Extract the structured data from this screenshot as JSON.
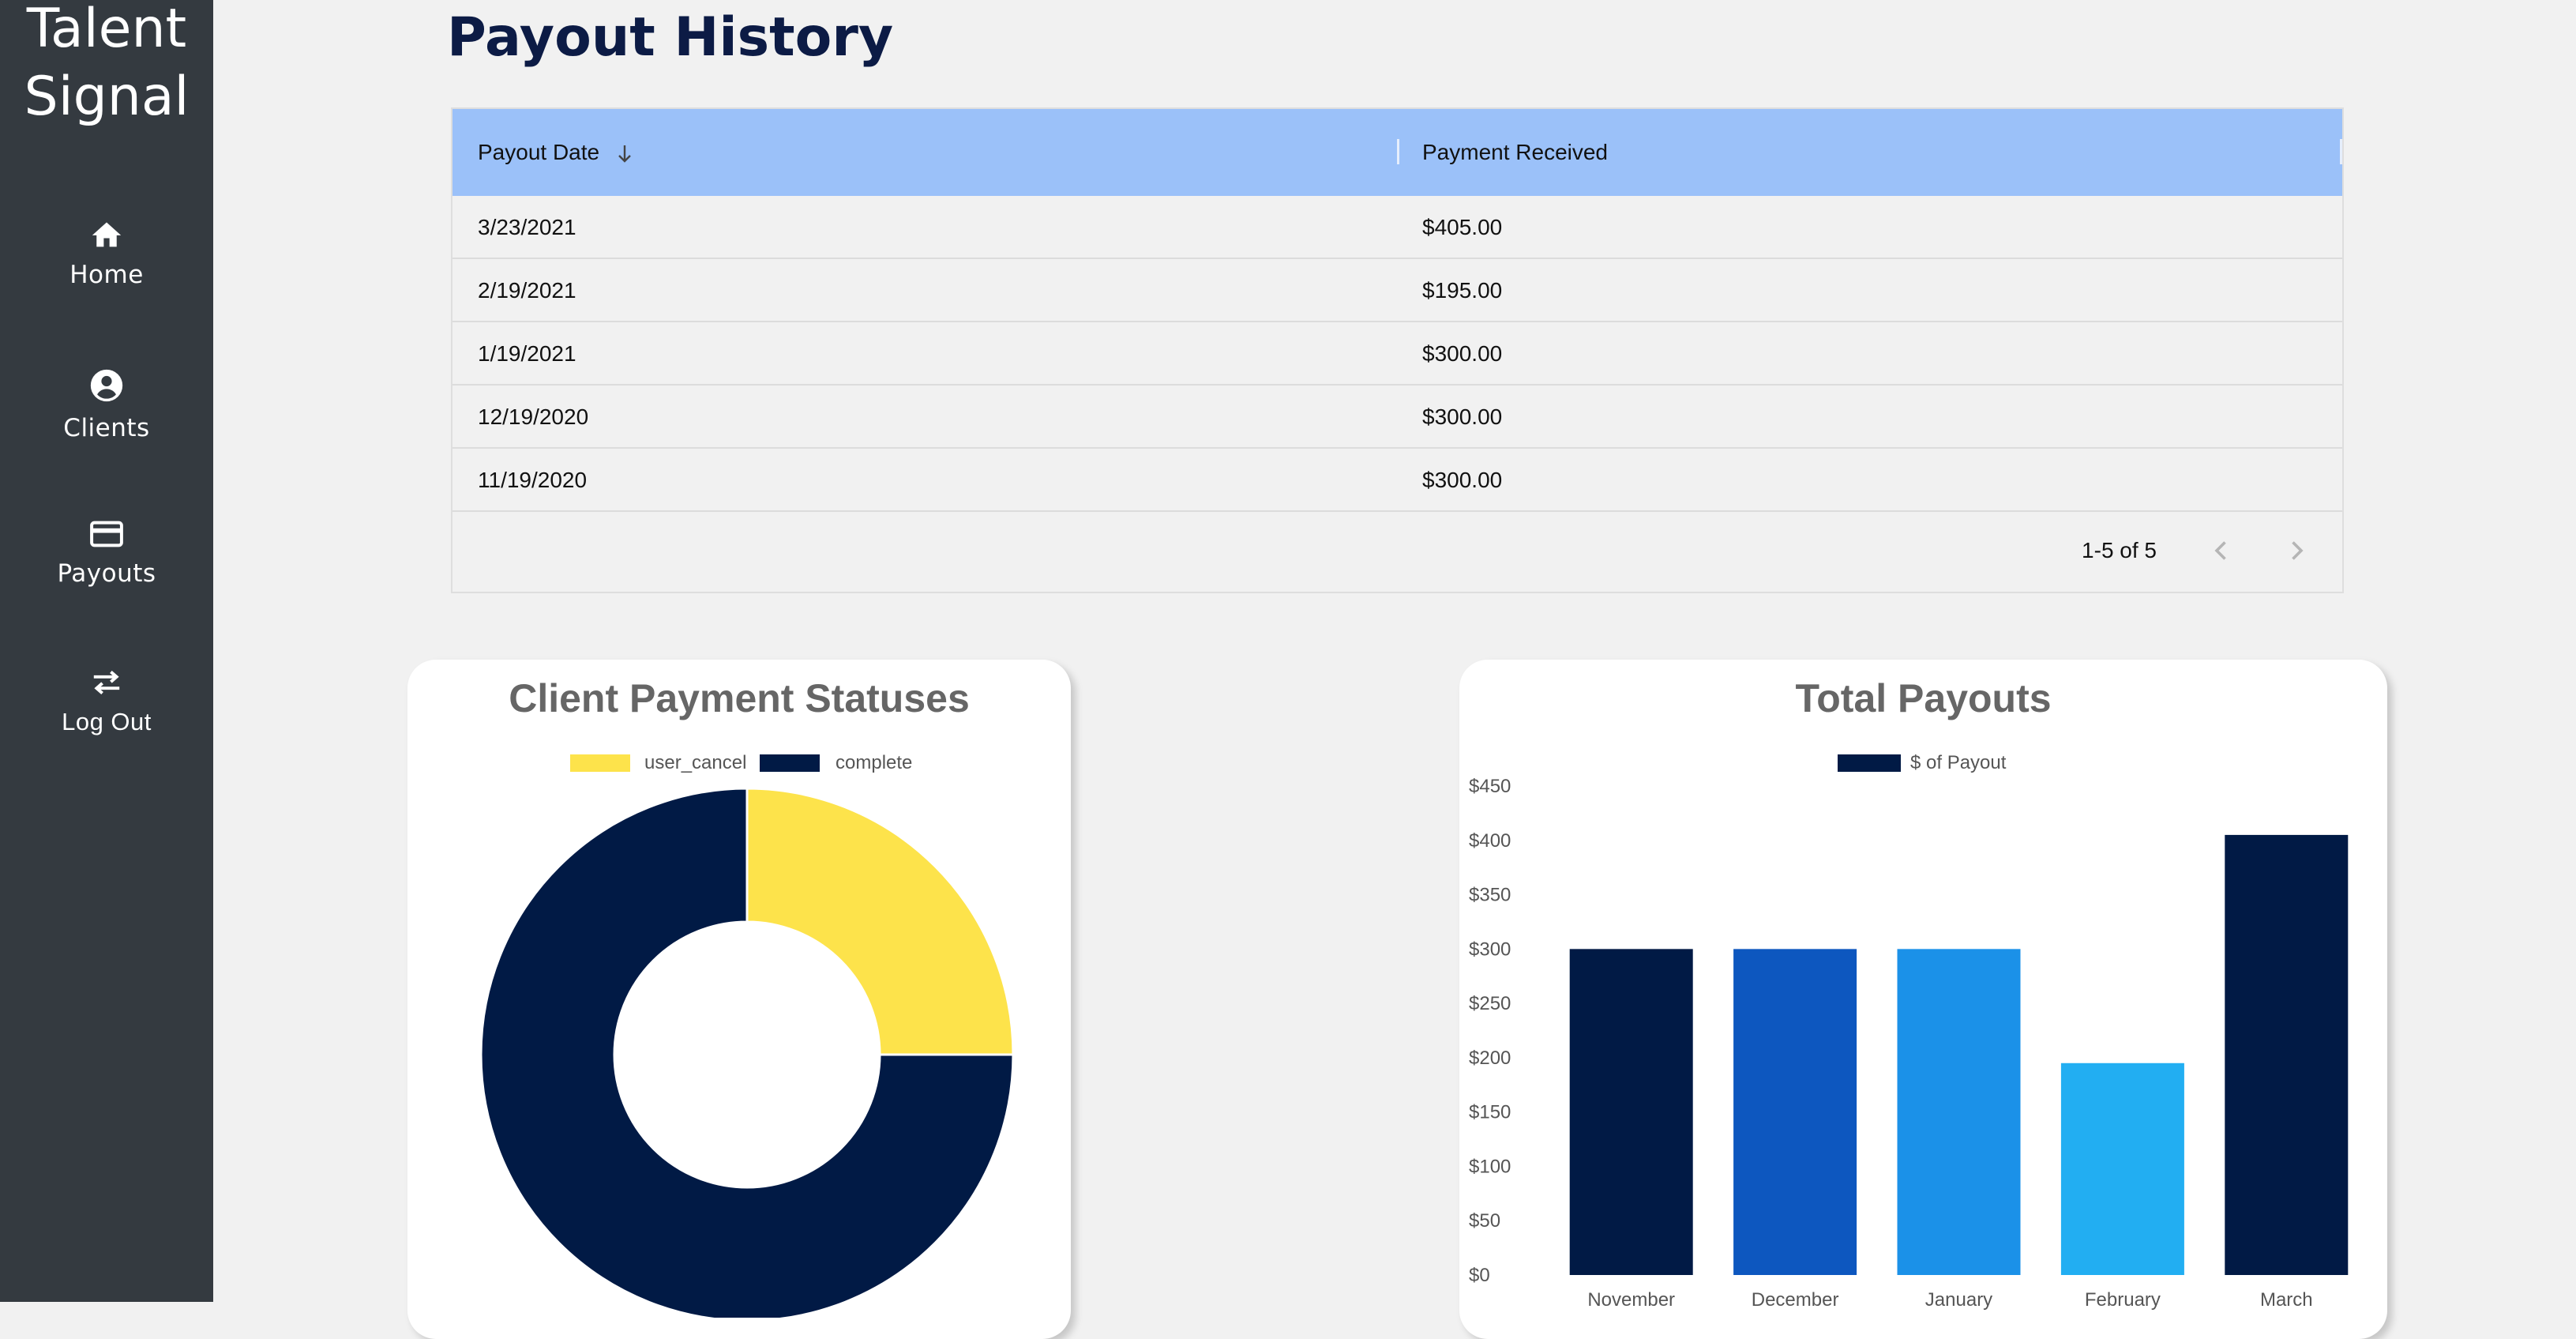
{
  "sidebar": {
    "brand": [
      "Talent",
      "Signal"
    ],
    "items": [
      {
        "label": "Home",
        "icon": "home-icon"
      },
      {
        "label": "Clients",
        "icon": "account-circle-icon"
      },
      {
        "label": "Payouts",
        "icon": "credit-card-icon"
      },
      {
        "label": "Log Out",
        "icon": "swap-arrows-icon"
      }
    ]
  },
  "page": {
    "title": "Payout History"
  },
  "table": {
    "columns": [
      "Payout Date",
      "Payment Received"
    ],
    "sort_icon": "arrow-down-icon",
    "rows": [
      [
        "3/23/2021",
        "$405.00"
      ],
      [
        "2/19/2021",
        "$195.00"
      ],
      [
        "1/19/2021",
        "$300.00"
      ],
      [
        "12/19/2020",
        "$300.00"
      ],
      [
        "11/19/2020",
        "$300.00"
      ]
    ],
    "pagination": "1-5 of 5"
  },
  "colors": {
    "navy": "#011a45",
    "yellow": "#fde34b",
    "blue1": "#0d57bf",
    "blue2": "#1b91e8",
    "blue3": "#22aef2",
    "header_blue": "#9bc1f9",
    "sidebar": "#343a40"
  },
  "chart_data": [
    {
      "type": "pie",
      "title": "Client Payment Statuses",
      "labels": [
        "user_cancel",
        "complete"
      ],
      "values": [
        1,
        3
      ],
      "colors": [
        "#fde34b",
        "#011a45"
      ],
      "legend": "top"
    },
    {
      "type": "bar",
      "title": "Total Payouts",
      "categories": [
        "November",
        "December",
        "January",
        "February",
        "March"
      ],
      "series": [
        {
          "name": "$ of Payout",
          "values": [
            300,
            300,
            300,
            195,
            405
          ]
        }
      ],
      "bar_colors": [
        "#011a45",
        "#0d57bf",
        "#1b91e8",
        "#22aef2",
        "#011a45"
      ],
      "ylim": [
        0,
        450
      ],
      "yticks": [
        "$0",
        "$50",
        "$100",
        "$150",
        "$200",
        "$250",
        "$300",
        "$350",
        "$400",
        "$450"
      ],
      "legend": "top"
    }
  ]
}
